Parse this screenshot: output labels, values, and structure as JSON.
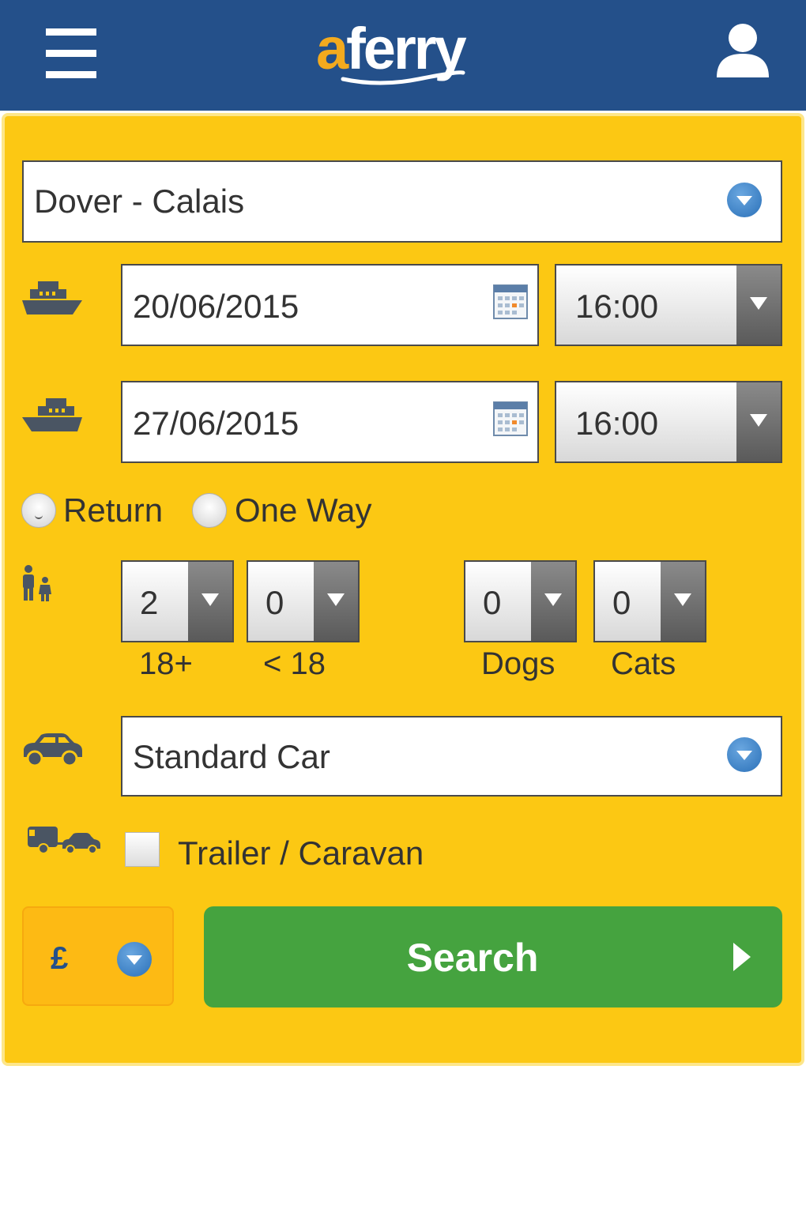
{
  "header": {
    "logo_prefix": "a",
    "logo_rest": "ferry",
    "menu_icon": "hamburger-menu-icon",
    "account_icon": "user-account-icon"
  },
  "colors": {
    "header_bg": "#24508a",
    "panel_bg": "#fcc813",
    "logo_accent": "#f3aa1e",
    "search_button": "#45a33f",
    "currency_bg": "#fdba14"
  },
  "route": {
    "selected": "Dover - Calais"
  },
  "outbound": {
    "date": "20/06/2015",
    "time": "16:00",
    "icon": "ferry-outbound-icon"
  },
  "inbound": {
    "date": "27/06/2015",
    "time": "16:00",
    "icon": "ferry-return-icon"
  },
  "trip_type": {
    "options": [
      "Return",
      "One Way"
    ],
    "selected": "Return"
  },
  "passengers": {
    "icon": "family-icon",
    "adults": {
      "value": "2",
      "label": "18+"
    },
    "children": {
      "value": "0",
      "label": "< 18"
    },
    "dogs": {
      "value": "0",
      "label": "Dogs"
    },
    "cats": {
      "value": "0",
      "label": "Cats"
    }
  },
  "vehicle": {
    "selected": "Standard Car",
    "icon": "car-icon"
  },
  "trailer": {
    "label": "Trailer / Caravan",
    "checked": false,
    "icon": "car-trailer-icon"
  },
  "currency": {
    "symbol": "£"
  },
  "search": {
    "label": "Search"
  }
}
